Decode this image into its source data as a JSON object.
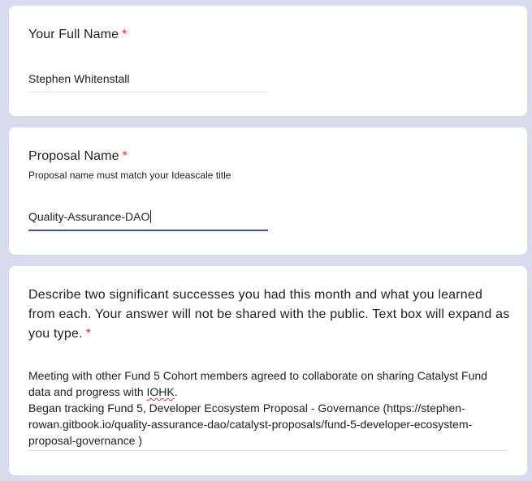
{
  "form": {
    "questions": [
      {
        "title": "Your Full Name",
        "required_marker": "*",
        "answer": "Stephen Whitenstall"
      },
      {
        "title": "Proposal Name",
        "required_marker": "*",
        "description": "Proposal name must match your Ideascale title",
        "answer": "Quality-Assurance-DAO"
      },
      {
        "title_lines": [
          "Describe two significant successes you had this month and what you learned",
          "from each. Your answer will not be shared with the public. Text box will expand as",
          "you type."
        ],
        "required_marker": "*",
        "answer_lines": {
          "line1": "Meeting with other Fund 5 Cohort members agreed to collaborate on sharing Catalyst Fund",
          "line2_prefix": "data and progress with ",
          "line2_flagged": "IOHK",
          "line2_suffix": ".",
          "line3": "Began tracking Fund 5, Developer Ecosystem Proposal - Governance  (https://stephen-",
          "line4": "rowan.gitbook.io/quality-assurance-dao/catalyst-proposals/fund-5-developer-ecosystem-",
          "line5": "proposal-governance )"
        }
      }
    ]
  }
}
